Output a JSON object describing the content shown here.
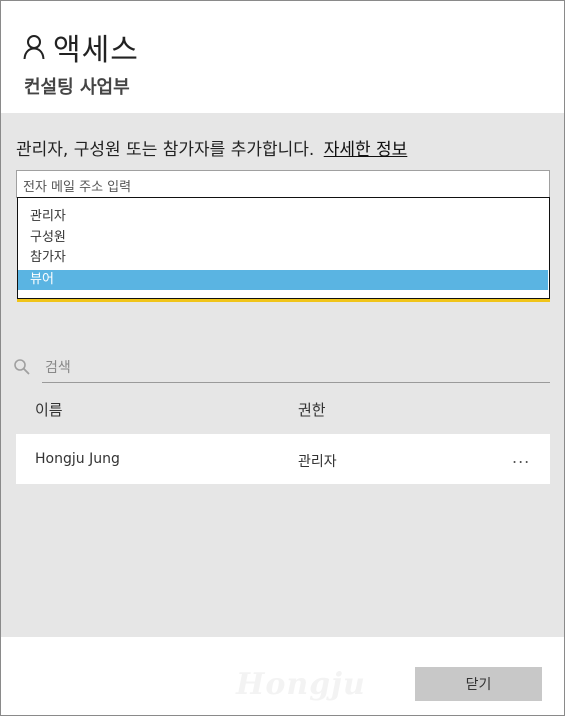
{
  "header": {
    "title": "액세스",
    "subtitle": "컨설팅 사업부"
  },
  "add_section": {
    "description": "관리자, 구성원 또는 참가자를 추가합니다.",
    "learn_more_link": "자세한 정보",
    "email_placeholder": "전자 메일 주소 입력"
  },
  "role_dropdown": {
    "options": [
      "관리자",
      "구성원",
      "참가자",
      "뷰어"
    ],
    "selected": "뷰어"
  },
  "search": {
    "placeholder": "검색"
  },
  "table": {
    "columns": [
      "이름",
      "권한"
    ],
    "rows": [
      {
        "name": "Hongju Jung",
        "permission": "관리자",
        "more": "..."
      }
    ]
  },
  "footer": {
    "watermark": "Hongju",
    "close_label": "닫기"
  },
  "colors": {
    "selected_option": "#5ab4e2",
    "accent_underline": "#f0c419",
    "panel_background": "#e6e6e6"
  }
}
